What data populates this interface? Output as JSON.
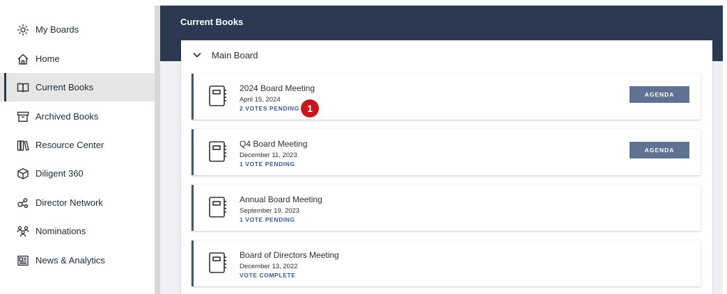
{
  "sidebar": {
    "items": [
      {
        "label": "My Boards",
        "icon": "my-boards-icon"
      },
      {
        "label": "Home",
        "icon": "home-icon"
      },
      {
        "label": "Current Books",
        "icon": "book-open-icon",
        "active": true
      },
      {
        "label": "Archived Books",
        "icon": "archive-icon"
      },
      {
        "label": "Resource Center",
        "icon": "library-icon"
      },
      {
        "label": "Diligent 360",
        "icon": "cube-icon"
      },
      {
        "label": "Director Network",
        "icon": "network-icon"
      },
      {
        "label": "Nominations",
        "icon": "people-icon"
      },
      {
        "label": "News & Analytics",
        "icon": "newspaper-icon"
      }
    ]
  },
  "main": {
    "title": "Current Books",
    "group": {
      "title": "Main Board",
      "books": [
        {
          "title": "2024 Board Meeting",
          "date": "April 15, 2024",
          "status": "2 VOTES PENDING",
          "agenda_label": "AGENDA",
          "badge": "1"
        },
        {
          "title": "Q4 Board Meeting",
          "date": "December 11, 2023",
          "status": "1 VOTE PENDING",
          "agenda_label": "AGENDA"
        },
        {
          "title": "Annual Board Meeting",
          "date": "September 19, 2023",
          "status": "1 VOTE PENDING"
        },
        {
          "title": "Board of Directors Meeting",
          "date": "December 13, 2022",
          "status": "VOTE COMPLETE"
        }
      ]
    }
  },
  "colors": {
    "header_bg": "#2b3a52",
    "accent_border": "#44536f",
    "status_text": "#3b5a8a",
    "button_bg": "#5f7291",
    "badge_bg": "#c8161d",
    "active_nav_bg": "#e6e6e6"
  }
}
